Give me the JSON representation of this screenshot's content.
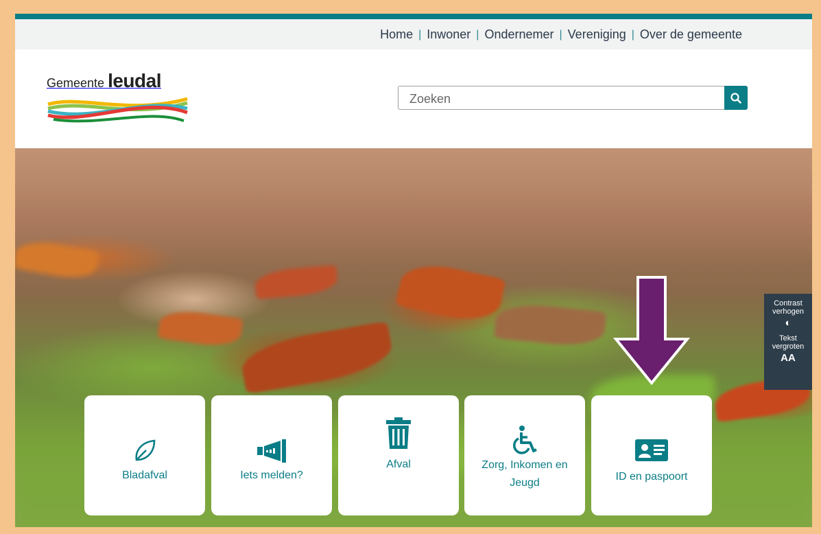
{
  "nav": {
    "items": [
      {
        "label": "Home"
      },
      {
        "label": "Inwoner"
      },
      {
        "label": "Ondernemer"
      },
      {
        "label": "Vereniging"
      },
      {
        "label": "Over de gemeente"
      }
    ],
    "separator": "|"
  },
  "logo": {
    "prefix": "Gemeente",
    "name": "leudal"
  },
  "search": {
    "placeholder": "Zoeken",
    "icon": "search-icon"
  },
  "accessibility": {
    "contrast_label": "Contrast verhogen",
    "contrast_icon": "half-circle-icon",
    "text_label": "Tekst vergroten",
    "text_glyph": "AA"
  },
  "tiles": [
    {
      "label": "Bladafval",
      "icon": "leaf-icon"
    },
    {
      "label": "Iets melden?",
      "icon": "megaphone-icon"
    },
    {
      "label": "Afval",
      "icon": "trash-icon"
    },
    {
      "label": "Zorg, Inkomen en Jeugd",
      "icon": "wheelchair-icon"
    },
    {
      "label": "ID en paspoort",
      "icon": "id-card-icon"
    }
  ],
  "colors": {
    "accent": "#0b7d86",
    "frame": "#f4c48c",
    "arrow": "#6a1f6e"
  }
}
